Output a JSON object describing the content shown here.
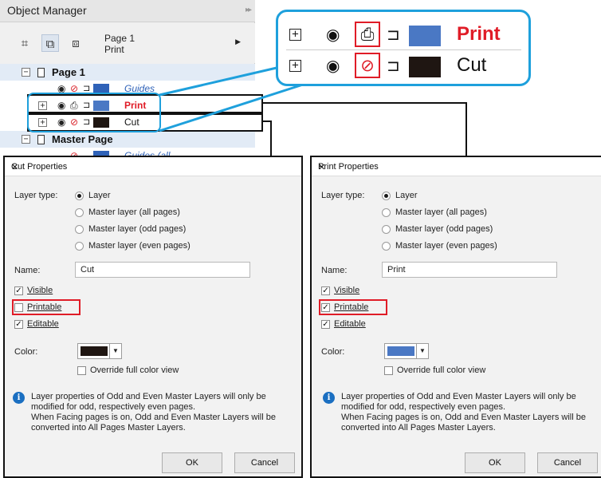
{
  "object_manager": {
    "title": "Object Manager",
    "page_name": "Page 1",
    "layer_name": "Print",
    "tree": {
      "page1": "Page 1",
      "guides": "Guides",
      "print": "Print",
      "cut": "Cut",
      "master": "Master Page",
      "guides_all": "Guides (all..."
    },
    "colors": {
      "print": "#4a78c4",
      "cut": "#1f1612",
      "guides": "#2f62b8"
    }
  },
  "zoom": {
    "print": "Print",
    "cut": "Cut"
  },
  "cut_dialog": {
    "title": "Cut Properties",
    "layer_type_label": "Layer type:",
    "opt_layer": "Layer",
    "opt_master_all": "Master layer (all pages)",
    "opt_master_odd": "Master layer (odd pages)",
    "opt_master_even": "Master layer (even pages)",
    "name_label": "Name:",
    "name_value": "Cut",
    "visible": "Visible",
    "printable": "Printable",
    "editable": "Editable",
    "color_label": "Color:",
    "color": "#1f1612",
    "override": "Override full color view",
    "info1": "Layer properties of Odd and Even Master Layers will only be",
    "info2": "modified for odd, respectively even pages.",
    "info3": "When Facing pages is on, Odd and Even Master Layers will be",
    "info4": "converted into All Pages Master Layers.",
    "ok": "OK",
    "cancel": "Cancel"
  },
  "print_dialog": {
    "title": "Print Properties",
    "layer_type_label": "Layer type:",
    "opt_layer": "Layer",
    "opt_master_all": "Master layer (all pages)",
    "opt_master_odd": "Master layer (odd pages)",
    "opt_master_even": "Master layer (even pages)",
    "name_label": "Name:",
    "name_value": "Print",
    "visible": "Visible",
    "printable": "Printable",
    "editable": "Editable",
    "color_label": "Color:",
    "color": "#4a78c4",
    "override": "Override full color view",
    "info1": "Layer properties of Odd and Even Master Layers will only be",
    "info2": "modified for odd, respectively even pages.",
    "info3": "When Facing pages is on, Odd and Even Master Layers will be",
    "info4": "converted into All Pages Master Layers.",
    "ok": "OK",
    "cancel": "Cancel"
  }
}
